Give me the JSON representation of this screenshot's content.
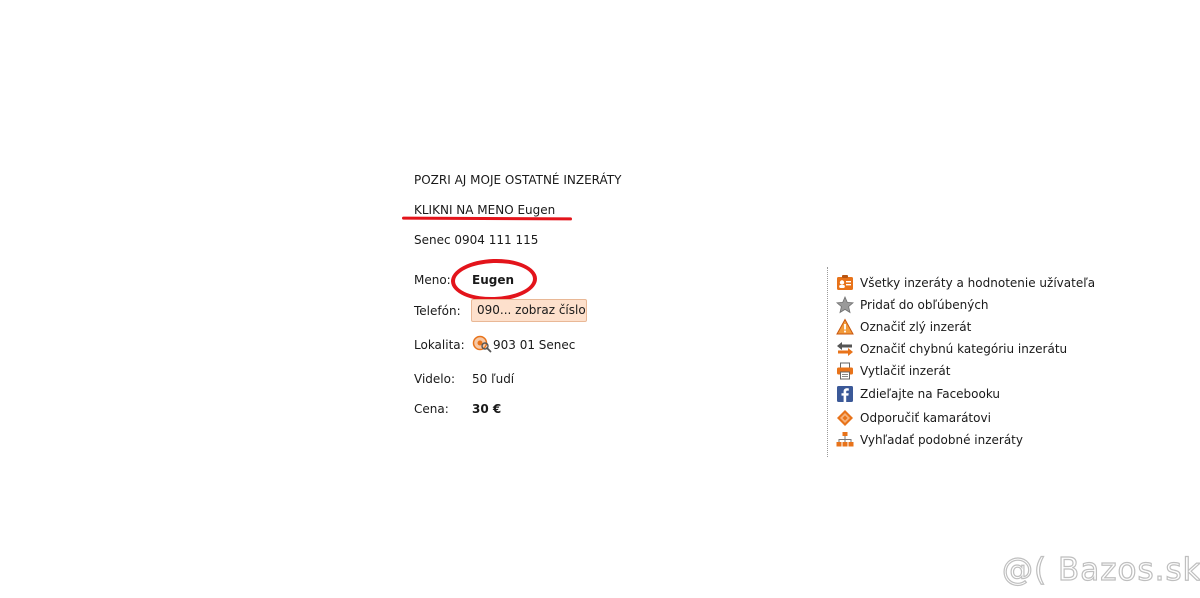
{
  "description": {
    "line1": "POZRI AJ MOJE OSTATNÉ INZERÁTY",
    "line2": "KLIKNI NA MENO Eugen",
    "line3": "Senec 0904 111 115"
  },
  "details": {
    "name_label": "Meno:",
    "name_value": "Eugen",
    "phone_label": "Telefón:",
    "phone_button": "090... zobraz číslo",
    "location_label": "Lokalita:",
    "location_value": "903 01 Senec",
    "views_label": "Videlo:",
    "views_value": "50 ľudí",
    "price_label": "Cena:",
    "price_value": "30 €"
  },
  "actions": [
    {
      "icon": "user-ads-icon",
      "label": "Všetky inzeráty a hodnotenie užívateľa"
    },
    {
      "icon": "star-icon",
      "label": "Pridať do obľúbených"
    },
    {
      "icon": "warning-icon",
      "label": "Označiť zlý inzerát"
    },
    {
      "icon": "swap-arrows-icon",
      "label": "Označiť chybnú kategóriu inzerátu"
    },
    {
      "icon": "printer-icon",
      "label": "Vytlačiť inzerát"
    },
    {
      "icon": "facebook-icon",
      "label": "Zdieľajte na Facebooku"
    },
    {
      "icon": "recommend-icon",
      "label": "Odporučiť kamarátovi"
    },
    {
      "icon": "sitemap-icon",
      "label": "Vyhľadať podobné inzeráty"
    }
  ],
  "watermark": {
    "text": "@( Bazos.sk"
  },
  "colors": {
    "annotation_red": "#e3141b",
    "phone_button_bg": "#fde0cc",
    "icon_orange": "#e8731a",
    "facebook_blue": "#3b5998"
  }
}
